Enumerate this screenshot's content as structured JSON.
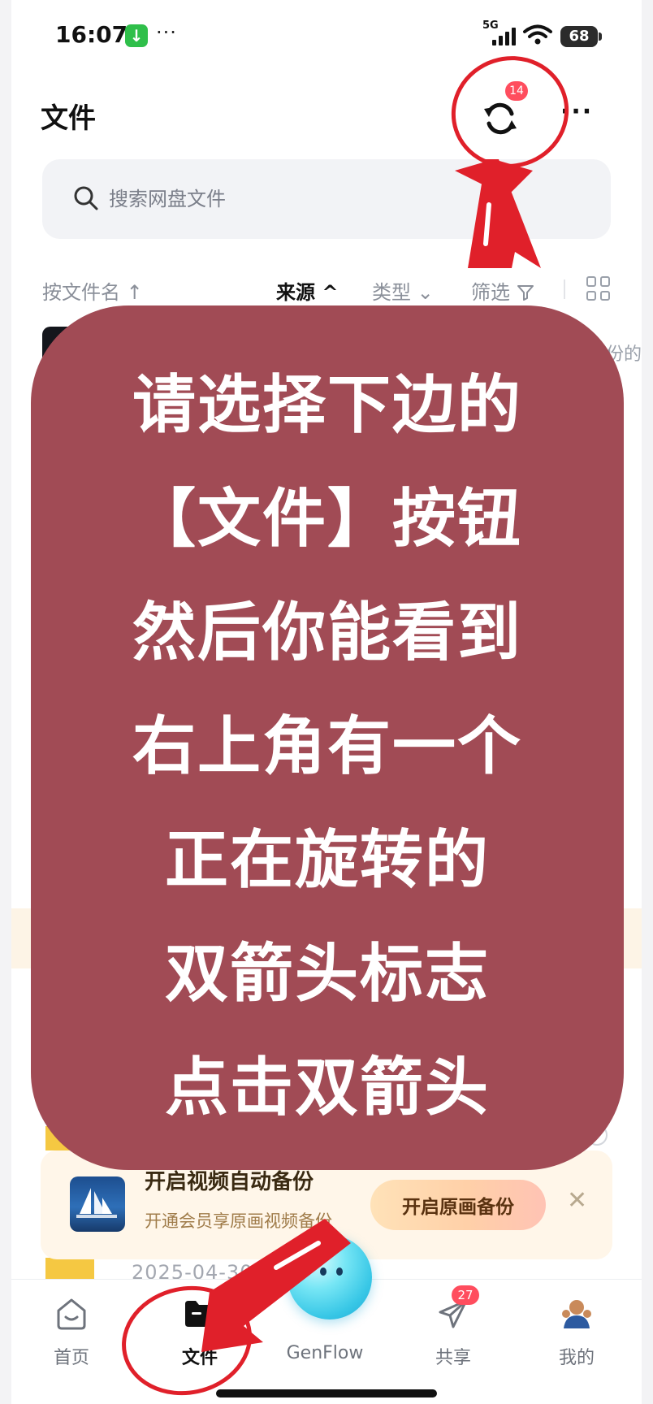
{
  "status_bar": {
    "time": "16:07",
    "dots": "···",
    "network": "5G",
    "battery": "68"
  },
  "header": {
    "title": "文件",
    "sync_badge_count": "14",
    "more_label": "···"
  },
  "search": {
    "placeholder": "搜索网盘文件"
  },
  "sort_bar": {
    "by_name": "按文件名 ↑",
    "source": "来源 ^",
    "type": "类型 ⌄",
    "filter": "筛选"
  },
  "list_peek": {
    "backup_fragment": "备份的",
    "date_fragment": "2025-04-30"
  },
  "backup_banner": {
    "title": "开启视频自动备份",
    "subtitle": "开通会员享原画视频备份",
    "button": "开启原画备份",
    "close": "✕"
  },
  "tab_bar": {
    "tabs": [
      {
        "label": "首页",
        "icon": "home-icon"
      },
      {
        "label": "文件",
        "icon": "folder-icon",
        "active": true
      },
      {
        "label": "GenFlow",
        "icon": "genflow-icon"
      },
      {
        "label": "共享",
        "icon": "send-icon",
        "badge": "27"
      },
      {
        "label": "我的",
        "icon": "avatar"
      }
    ]
  },
  "overlay": {
    "lines": [
      "请选择下边的",
      "【文件】按钮",
      "然后你能看到",
      "右上角有一个",
      "正在旋转的",
      "双箭头标志",
      "点击双箭头"
    ]
  },
  "colors": {
    "overlay_bg": "#a14b55",
    "annotation_red": "#e0202a",
    "badge_red": "#ff4d5e",
    "banner_bg": "#fff6e9",
    "search_bg": "#f2f3f6"
  }
}
